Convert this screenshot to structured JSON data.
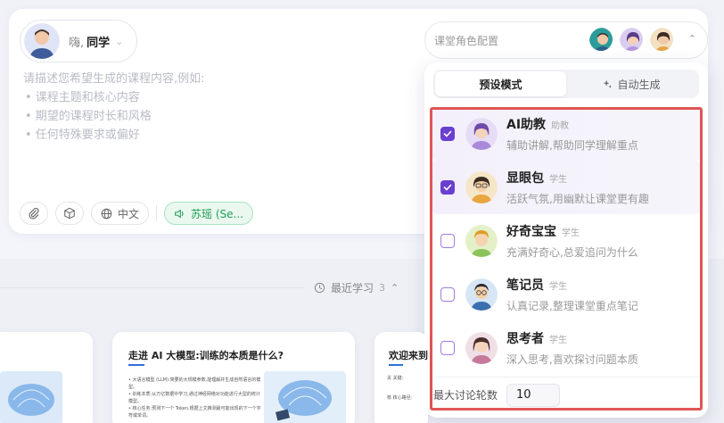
{
  "greeting": {
    "hi": "嗨,",
    "name": "同学"
  },
  "prompt": {
    "intro": "请描述您希望生成的课程内容,例如:",
    "bullets": [
      "• 课程主题和核心内容",
      "• 期望的课程时长和风格",
      "• 任何特殊要求或偏好"
    ]
  },
  "toolbar": {
    "language": "中文",
    "voice": "苏瑶 (Se..."
  },
  "role_config": {
    "label": "课堂角色配置"
  },
  "mode_tabs": [
    {
      "label": "预设模式",
      "active": true
    },
    {
      "label": "自动生成",
      "active": false
    }
  ],
  "roles": [
    {
      "name": "AI助教",
      "tag": "助教",
      "desc": "辅助讲解,帮助同学理解重点",
      "checked": true
    },
    {
      "name": "显眼包",
      "tag": "学生",
      "desc": "活跃气氛,用幽默让课堂更有趣",
      "checked": true
    },
    {
      "name": "好奇宝宝",
      "tag": "学生",
      "desc": "充满好奇心,总爱追问为什么",
      "checked": false
    },
    {
      "name": "笔记员",
      "tag": "学生",
      "desc": "认真记录,整理课堂重点笔记",
      "checked": false
    },
    {
      "name": "思考者",
      "tag": "学生",
      "desc": "深入思考,喜欢探讨问题本质",
      "checked": false
    }
  ],
  "rounds": {
    "label": "最大讨论轮数",
    "value": "10"
  },
  "recent": {
    "label": "最近学习",
    "count": "3"
  },
  "cards": [
    {
      "title": ""
    },
    {
      "title": "走进 AI 大模型:训练的本质是什么?",
      "bullets": [
        "• 大语言模型 (LLM):简要的大规模参数,能理解并生成自然语言的模型。",
        "• 训练本质:从万亿数据中学习,通过神经网络对功能进行大型的统计模型。",
        "• 核心任务:预测下一个 Token,根据上文推测最可能出现的下一个字符或单词。"
      ]
    },
    {
      "title": "欢迎来到",
      "bullets": [
        "关 关键:",
        "核 核心路径:"
      ]
    }
  ],
  "colors": {
    "accent": "#6a3fd0",
    "voice": "#1f9d57",
    "highlight": "#e05555"
  }
}
